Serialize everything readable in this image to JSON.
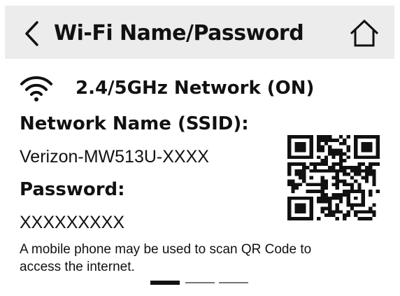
{
  "header": {
    "title": "Wi-Fi Name/Password",
    "back_icon": "chevron-left-icon",
    "home_icon": "home-icon"
  },
  "network": {
    "status": "2.4/5GHz Network (ON)",
    "icon": "wifi-icon"
  },
  "ssid": {
    "label": "Network Name (SSID):",
    "value": "Verizon-MW513U-XXXX"
  },
  "password": {
    "label": "Password:",
    "value": "XXXXXXXXX"
  },
  "hint": "A mobile phone may be used to scan QR Code to access the internet.",
  "pager": {
    "total": 3,
    "current": 1
  },
  "colors": {
    "header_bg": "#ececec",
    "text": "#111111"
  }
}
